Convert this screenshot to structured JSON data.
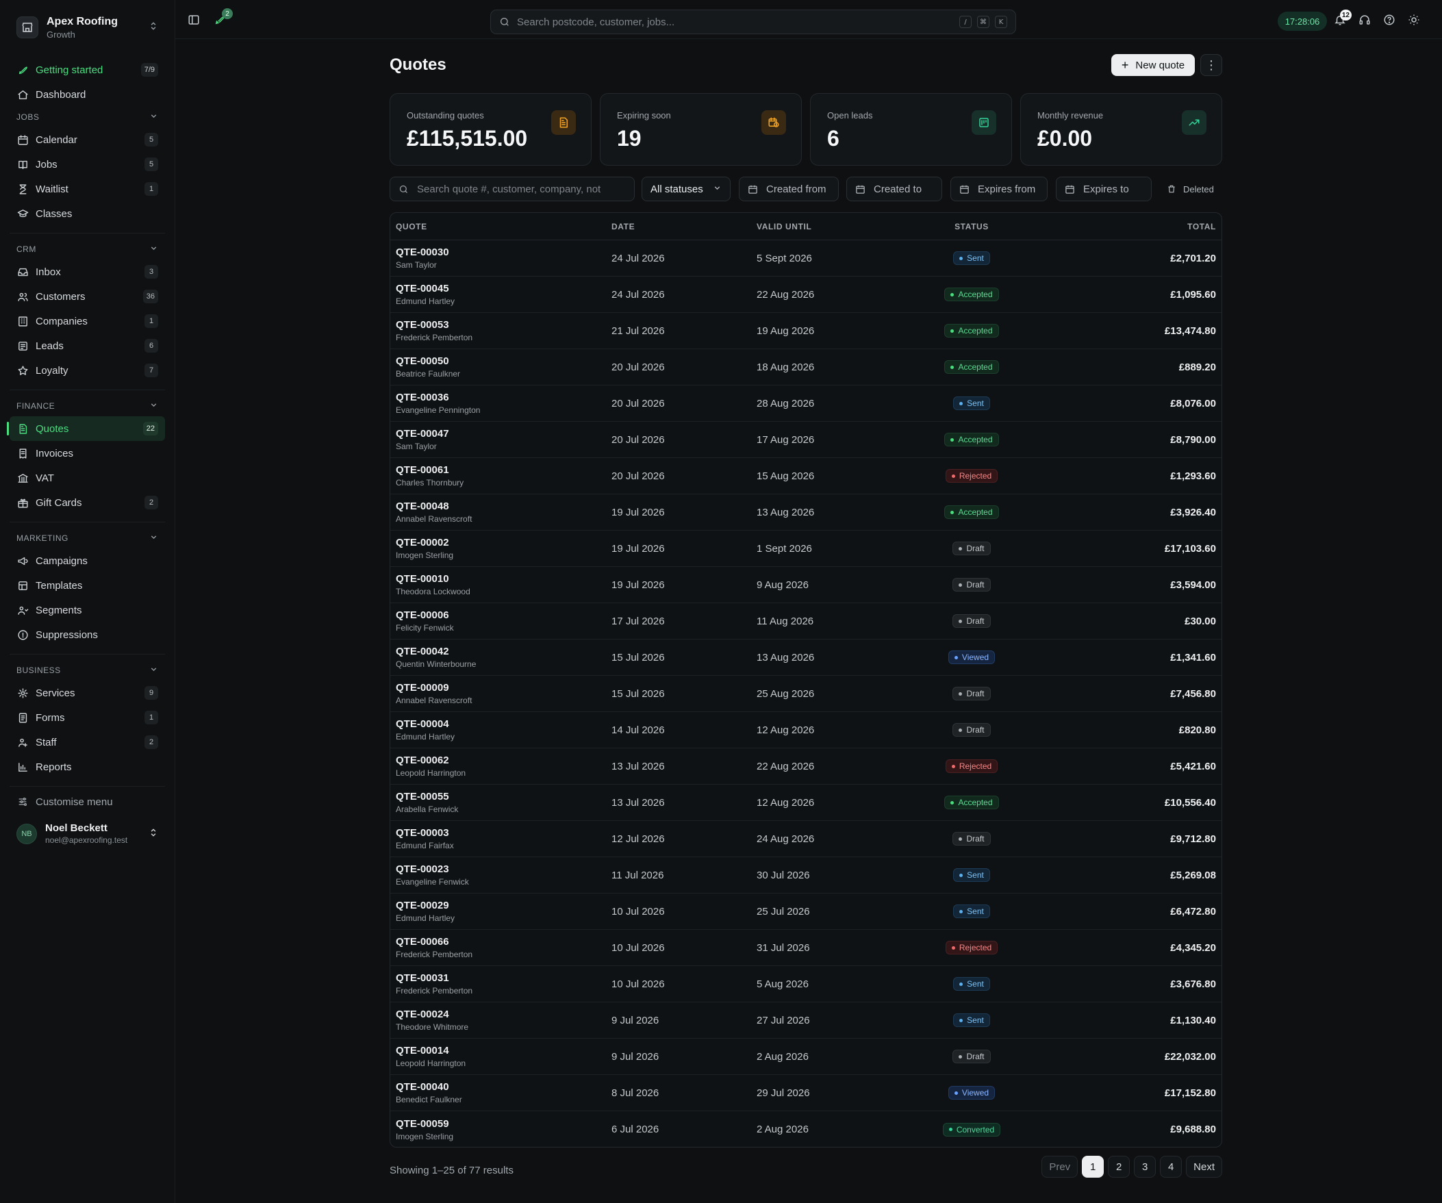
{
  "brand": {
    "name": "Apex Roofing",
    "plan": "Growth"
  },
  "sidebar": {
    "top": [
      {
        "label": "Getting started",
        "count": "7/9",
        "icon": "rocket-icon"
      },
      {
        "label": "Dashboard",
        "icon": "home-icon"
      }
    ],
    "sections": [
      {
        "title": "JOBS",
        "items": [
          {
            "label": "Calendar",
            "count": "5",
            "icon": "calendar-icon"
          },
          {
            "label": "Jobs",
            "count": "5",
            "icon": "book-icon"
          },
          {
            "label": "Waitlist",
            "count": "1",
            "icon": "hourglass-icon"
          },
          {
            "label": "Classes",
            "icon": "graduation-cap-icon"
          }
        ]
      },
      {
        "title": "CRM",
        "items": [
          {
            "label": "Inbox",
            "count": "3",
            "icon": "inbox-icon"
          },
          {
            "label": "Customers",
            "count": "36",
            "icon": "users-icon"
          },
          {
            "label": "Companies",
            "count": "1",
            "icon": "building-icon"
          },
          {
            "label": "Leads",
            "count": "6",
            "icon": "leads-icon"
          },
          {
            "label": "Loyalty",
            "count": "7",
            "icon": "star-icon"
          }
        ]
      },
      {
        "title": "FINANCE",
        "items": [
          {
            "label": "Quotes",
            "count": "22",
            "icon": "file-text-icon",
            "active": true
          },
          {
            "label": "Invoices",
            "icon": "receipt-icon"
          },
          {
            "label": "VAT",
            "icon": "bank-icon"
          },
          {
            "label": "Gift Cards",
            "count": "2",
            "icon": "gift-icon"
          }
        ]
      },
      {
        "title": "MARKETING",
        "items": [
          {
            "label": "Campaigns",
            "icon": "megaphone-icon"
          },
          {
            "label": "Templates",
            "icon": "template-icon"
          },
          {
            "label": "Segments",
            "icon": "segments-icon"
          },
          {
            "label": "Suppressions",
            "icon": "alert-circle-icon"
          }
        ]
      },
      {
        "title": "BUSINESS",
        "items": [
          {
            "label": "Services",
            "count": "9",
            "icon": "services-icon"
          },
          {
            "label": "Forms",
            "count": "1",
            "icon": "form-icon"
          },
          {
            "label": "Staff",
            "count": "2",
            "icon": "staff-icon"
          },
          {
            "label": "Reports",
            "icon": "bar-chart-icon"
          }
        ]
      }
    ],
    "customise": "Customise menu",
    "user": {
      "initials": "NB",
      "name": "Noel Beckett",
      "email": "noel@apexroofing.test"
    }
  },
  "topbar": {
    "rocket_badge": "2",
    "search_placeholder": "Search postcode, customer, jobs...",
    "shortcut_keys": [
      "/",
      "⌘",
      "K"
    ],
    "clock": "17:28:06",
    "notifications_count": "12"
  },
  "page": {
    "title": "Quotes",
    "new_quote_label": "New quote"
  },
  "stats": [
    {
      "label": "Outstanding quotes",
      "value": "£115,515.00",
      "icon": "document-icon",
      "tone": "orange"
    },
    {
      "label": "Expiring soon",
      "value": "19",
      "icon": "calendar-clock-icon",
      "tone": "orange"
    },
    {
      "label": "Open leads",
      "value": "6",
      "icon": "lead-board-icon",
      "tone": "teal"
    },
    {
      "label": "Monthly revenue",
      "value": "£0.00",
      "icon": "trending-up-icon",
      "tone": "teal"
    }
  ],
  "filters": {
    "search_placeholder": "Search quote #, customer, company, not",
    "status": "All statuses",
    "created_from": "Created from",
    "created_to": "Created to",
    "expires_from": "Expires from",
    "expires_to": "Expires to",
    "deleted": "Deleted"
  },
  "table": {
    "headers": {
      "quote": "QUOTE",
      "date": "DATE",
      "valid": "VALID UNTIL",
      "status": "STATUS",
      "total": "TOTAL"
    },
    "rows": [
      {
        "num": "QTE-00030",
        "name": "Sam Taylor",
        "date": "24 Jul 2026",
        "valid": "5 Sept 2026",
        "status": "Sent",
        "total": "£2,701.20"
      },
      {
        "num": "QTE-00045",
        "name": "Edmund Hartley",
        "date": "24 Jul 2026",
        "valid": "22 Aug 2026",
        "status": "Accepted",
        "total": "£1,095.60"
      },
      {
        "num": "QTE-00053",
        "name": "Frederick Pemberton",
        "date": "21 Jul 2026",
        "valid": "19 Aug 2026",
        "status": "Accepted",
        "total": "£13,474.80"
      },
      {
        "num": "QTE-00050",
        "name": "Beatrice Faulkner",
        "date": "20 Jul 2026",
        "valid": "18 Aug 2026",
        "status": "Accepted",
        "total": "£889.20"
      },
      {
        "num": "QTE-00036",
        "name": "Evangeline Pennington",
        "date": "20 Jul 2026",
        "valid": "28 Aug 2026",
        "status": "Sent",
        "total": "£8,076.00"
      },
      {
        "num": "QTE-00047",
        "name": "Sam Taylor",
        "date": "20 Jul 2026",
        "valid": "17 Aug 2026",
        "status": "Accepted",
        "total": "£8,790.00"
      },
      {
        "num": "QTE-00061",
        "name": "Charles Thornbury",
        "date": "20 Jul 2026",
        "valid": "15 Aug 2026",
        "status": "Rejected",
        "total": "£1,293.60"
      },
      {
        "num": "QTE-00048",
        "name": "Annabel Ravenscroft",
        "date": "19 Jul 2026",
        "valid": "13 Aug 2026",
        "status": "Accepted",
        "total": "£3,926.40"
      },
      {
        "num": "QTE-00002",
        "name": "Imogen Sterling",
        "date": "19 Jul 2026",
        "valid": "1 Sept 2026",
        "status": "Draft",
        "total": "£17,103.60"
      },
      {
        "num": "QTE-00010",
        "name": "Theodora Lockwood",
        "date": "19 Jul 2026",
        "valid": "9 Aug 2026",
        "status": "Draft",
        "total": "£3,594.00"
      },
      {
        "num": "QTE-00006",
        "name": "Felicity Fenwick",
        "date": "17 Jul 2026",
        "valid": "11 Aug 2026",
        "status": "Draft",
        "total": "£30.00"
      },
      {
        "num": "QTE-00042",
        "name": "Quentin Winterbourne",
        "date": "15 Jul 2026",
        "valid": "13 Aug 2026",
        "status": "Viewed",
        "total": "£1,341.60"
      },
      {
        "num": "QTE-00009",
        "name": "Annabel Ravenscroft",
        "date": "15 Jul 2026",
        "valid": "25 Aug 2026",
        "status": "Draft",
        "total": "£7,456.80"
      },
      {
        "num": "QTE-00004",
        "name": "Edmund Hartley",
        "date": "14 Jul 2026",
        "valid": "12 Aug 2026",
        "status": "Draft",
        "total": "£820.80"
      },
      {
        "num": "QTE-00062",
        "name": "Leopold Harrington",
        "date": "13 Jul 2026",
        "valid": "22 Aug 2026",
        "status": "Rejected",
        "total": "£5,421.60"
      },
      {
        "num": "QTE-00055",
        "name": "Arabella Fenwick",
        "date": "13 Jul 2026",
        "valid": "12 Aug 2026",
        "status": "Accepted",
        "total": "£10,556.40"
      },
      {
        "num": "QTE-00003",
        "name": "Edmund Fairfax",
        "date": "12 Jul 2026",
        "valid": "24 Aug 2026",
        "status": "Draft",
        "total": "£9,712.80"
      },
      {
        "num": "QTE-00023",
        "name": "Evangeline Fenwick",
        "date": "11 Jul 2026",
        "valid": "30 Jul 2026",
        "status": "Sent",
        "total": "£5,269.08"
      },
      {
        "num": "QTE-00029",
        "name": "Edmund Hartley",
        "date": "10 Jul 2026",
        "valid": "25 Jul 2026",
        "status": "Sent",
        "total": "£6,472.80"
      },
      {
        "num": "QTE-00066",
        "name": "Frederick Pemberton",
        "date": "10 Jul 2026",
        "valid": "31 Jul 2026",
        "status": "Rejected",
        "total": "£4,345.20"
      },
      {
        "num": "QTE-00031",
        "name": "Frederick Pemberton",
        "date": "10 Jul 2026",
        "valid": "5 Aug 2026",
        "status": "Sent",
        "total": "£3,676.80"
      },
      {
        "num": "QTE-00024",
        "name": "Theodore Whitmore",
        "date": "9 Jul 2026",
        "valid": "27 Jul 2026",
        "status": "Sent",
        "total": "£1,130.40"
      },
      {
        "num": "QTE-00014",
        "name": "Leopold Harrington",
        "date": "9 Jul 2026",
        "valid": "2 Aug 2026",
        "status": "Draft",
        "total": "£22,032.00"
      },
      {
        "num": "QTE-00040",
        "name": "Benedict Faulkner",
        "date": "8 Jul 2026",
        "valid": "29 Jul 2026",
        "status": "Viewed",
        "total": "£17,152.80"
      },
      {
        "num": "QTE-00059",
        "name": "Imogen Sterling",
        "date": "6 Jul 2026",
        "valid": "2 Aug 2026",
        "status": "Converted",
        "total": "£9,688.80"
      }
    ]
  },
  "footer": {
    "results": "Showing 1–25 of 77 results",
    "prev": "Prev",
    "pages": [
      "1",
      "2",
      "3",
      "4"
    ],
    "current_page": "1",
    "next": "Next"
  }
}
